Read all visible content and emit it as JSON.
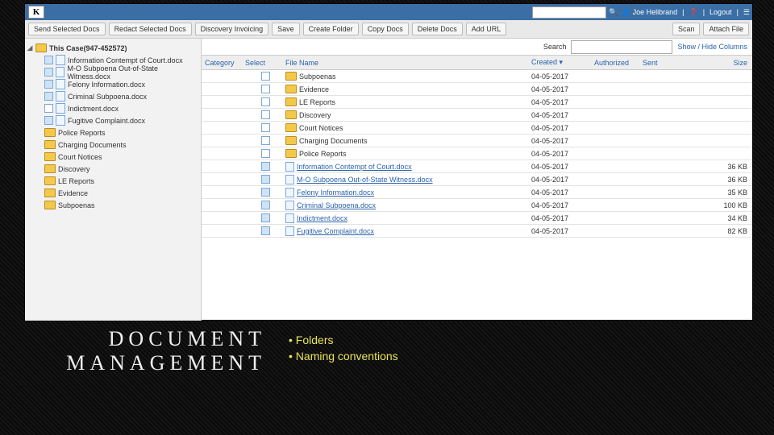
{
  "slide": {
    "title_l1": "DOCUMENT",
    "title_l2": "MANAGEMENT",
    "bullets": [
      "Folders",
      "Naming conventions"
    ]
  },
  "top": {
    "logo": "K",
    "user": "Joe Helibrand",
    "logout": "Logout"
  },
  "toolbar": {
    "send": "Send Selected Docs",
    "redact": "Redact Selected Docs",
    "disc": "Discovery Invoicing",
    "save": "Save",
    "create": "Create Folder",
    "copy": "Copy Docs",
    "delete": "Delete Docs",
    "url": "Add URL",
    "scan": "Scan",
    "attach": "Attach File"
  },
  "tree": {
    "root": "This Case(947-452572)",
    "docs": [
      {
        "n": "Information Contempt of Court.docx",
        "ck": true
      },
      {
        "n": "M-O Subpoena Out-of-State Witness.docx",
        "ck": true
      },
      {
        "n": "Felony Information.docx",
        "ck": true
      },
      {
        "n": "Criminal Subpoena.docx",
        "ck": true
      },
      {
        "n": "Indictment.docx",
        "ck": false
      },
      {
        "n": "Fugitive Complaint.docx",
        "ck": true
      }
    ],
    "folders": [
      "Police Reports",
      "Charging Documents",
      "Court Notices",
      "Discovery",
      "LE Reports",
      "Evidence",
      "Subpoenas"
    ]
  },
  "searchrow": {
    "label": "Search",
    "showhide": "Show / Hide Columns"
  },
  "columns": {
    "cat": "Category",
    "sel": "Select",
    "name": "File Name",
    "created": "Created",
    "auth": "Authorized",
    "sent": "Sent",
    "size": "Size"
  },
  "rows": [
    {
      "t": "f",
      "n": "Subpoenas",
      "d": "04-05-2017"
    },
    {
      "t": "f",
      "n": "Evidence",
      "d": "04-05-2017"
    },
    {
      "t": "f",
      "n": "LE Reports",
      "d": "04-05-2017"
    },
    {
      "t": "f",
      "n": "Discovery",
      "d": "04-05-2017"
    },
    {
      "t": "f",
      "n": "Court Notices",
      "d": "04-05-2017"
    },
    {
      "t": "f",
      "n": "Charging Documents",
      "d": "04-05-2017"
    },
    {
      "t": "f",
      "n": "Police Reports",
      "d": "04-05-2017"
    },
    {
      "t": "d",
      "n": "Information Contempt of Court.docx",
      "d": "04-05-2017",
      "s": "36 KB",
      "ck": true
    },
    {
      "t": "d",
      "n": "M-O Subpoena Out-of-State Witness.docx",
      "d": "04-05-2017",
      "s": "36 KB",
      "ck": true
    },
    {
      "t": "d",
      "n": "Felony Information.docx",
      "d": "04-05-2017",
      "s": "35 KB",
      "ck": true
    },
    {
      "t": "d",
      "n": "Criminal Subpoena.docx",
      "d": "04-05-2017",
      "s": "100 KB",
      "ck": true
    },
    {
      "t": "d",
      "n": "Indictment.docx",
      "d": "04-05-2017",
      "s": "34 KB",
      "ck": true
    },
    {
      "t": "d",
      "n": "Fugitive Complaint.docx",
      "d": "04-05-2017",
      "s": "82 KB",
      "ck": true
    }
  ]
}
